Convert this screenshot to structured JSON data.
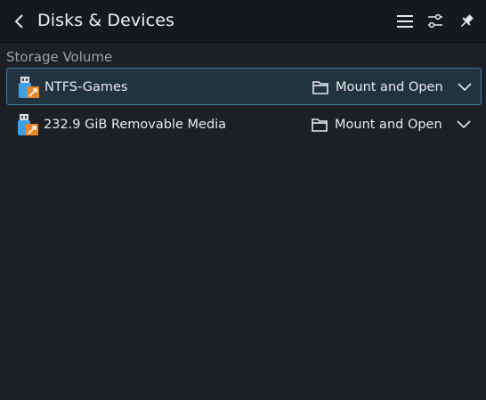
{
  "header": {
    "title": "Disks & Devices",
    "back_icon": "back-arrow-icon",
    "menu_icon": "hamburger-menu-icon",
    "settings_icon": "sliders-configure-icon",
    "pin_icon": "pin-icon"
  },
  "section": {
    "title": "Storage Volume"
  },
  "devices": [
    {
      "label": "NTFS-Games",
      "icon": "usb-drive-icon",
      "action_label": "Mount and Open",
      "action_icon": "folder-icon",
      "expand_icon": "chevron-down-icon",
      "selected": true
    },
    {
      "label": "232.9 GiB Removable Media",
      "icon": "usb-drive-icon",
      "action_label": "Mount and Open",
      "action_icon": "folder-icon",
      "expand_icon": "chevron-down-icon",
      "selected": false
    }
  ],
  "colors": {
    "accent": "#3d7fa8",
    "selected_bg": "#223340",
    "usb_orange": "#e8862a",
    "usb_blue": "#3aa0e8"
  }
}
